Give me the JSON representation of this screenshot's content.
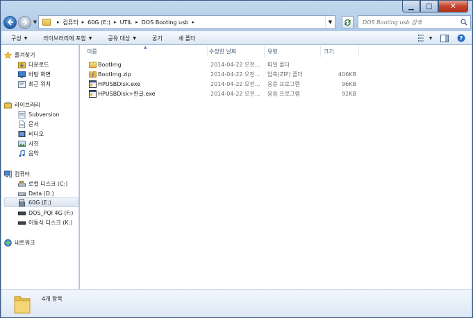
{
  "window": {
    "caption_buttons": {
      "minimize": "▁",
      "maximize": "□",
      "close": "✕"
    }
  },
  "address_bar": {
    "breadcrumbs": [
      "컴퓨터",
      "60G (E:)",
      "UTIL",
      "DOS Booting usb"
    ]
  },
  "search": {
    "placeholder": "DOS Booting usb 검색"
  },
  "toolbar": {
    "organize": "구성",
    "include_library": "라이브러리에 포함",
    "share_with": "공유 대상",
    "burn": "굽기",
    "new_folder": "새 폴더"
  },
  "nav": {
    "favorites": {
      "label": "즐겨찾기",
      "items": [
        "다운로드",
        "바탕 화면",
        "최근 위치"
      ]
    },
    "libraries": {
      "label": "라이브러리",
      "items": [
        "Subversion",
        "문서",
        "비디오",
        "사진",
        "음악"
      ]
    },
    "computer": {
      "label": "컴퓨터",
      "items": [
        "로컬 디스크 (C:)",
        "Data (D:)",
        "60G (E:)",
        "DOS_PQI 4G (F:)",
        "이동식 디스크 (K:)"
      ],
      "selected": "60G (E:)"
    },
    "network": {
      "label": "네트워크"
    }
  },
  "columns": {
    "name": "이름",
    "date": "수정한 날짜",
    "type": "유형",
    "size": "크기"
  },
  "files": [
    {
      "name": "BootImg",
      "date": "2014-04-22 오전...",
      "type": "파일 폴더",
      "size": "",
      "icon": "folder-icon"
    },
    {
      "name": "BootImg.zip",
      "date": "2014-04-22 오전...",
      "type": "압축(ZIP) 폴더",
      "size": "406KB",
      "icon": "zip-folder-icon"
    },
    {
      "name": "HPUSBDisk.exe",
      "date": "2014-04-22 오전...",
      "type": "응용 프로그램",
      "size": "96KB",
      "icon": "exe-icon"
    },
    {
      "name": "HPUSBDisk+한글.exe",
      "date": "2014-04-22 오전...",
      "type": "응용 프로그램",
      "size": "92KB",
      "icon": "exe-icon"
    }
  ],
  "details": {
    "item_count": "4개 항목"
  },
  "colors": {
    "selection": "#dbe5f0",
    "accent": "#1f5eaa",
    "frame": "#a9c4e4"
  }
}
